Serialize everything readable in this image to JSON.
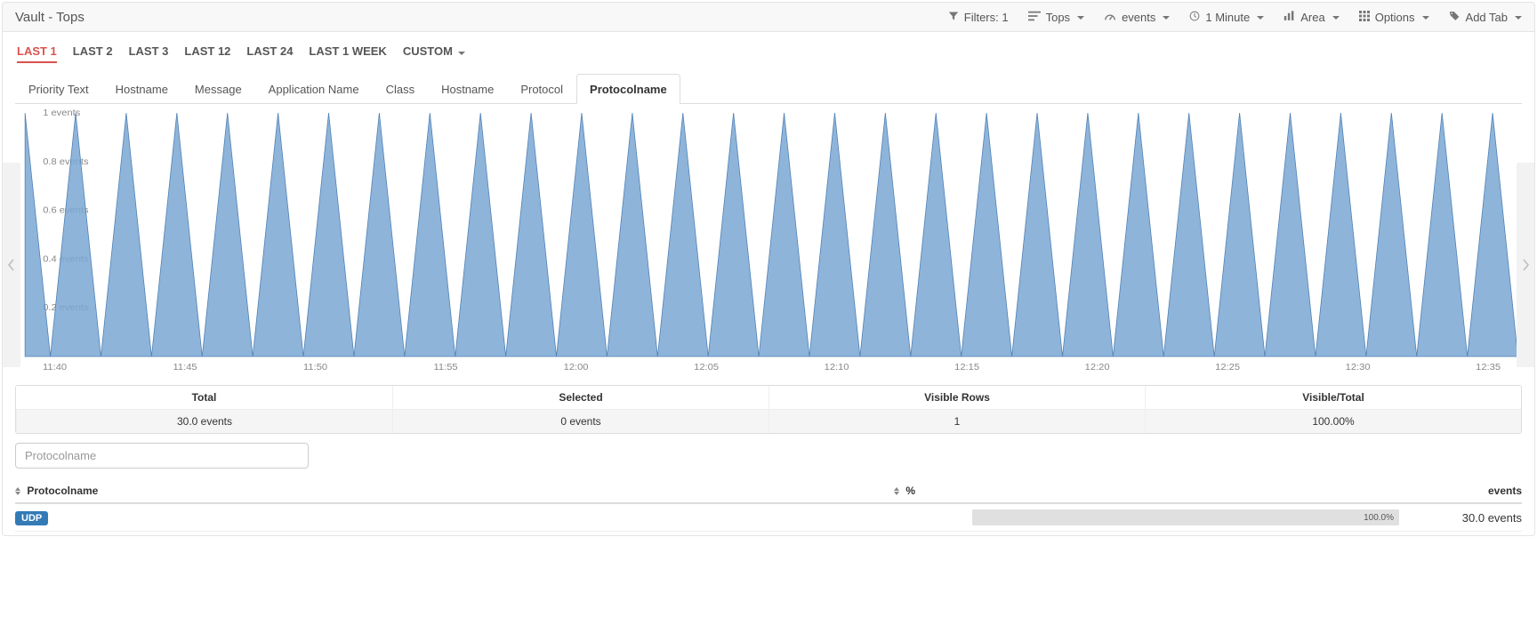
{
  "topbar": {
    "title": "Vault - Tops",
    "filters": "Filters: 1",
    "tops": "Tops",
    "events": "events",
    "interval": "1 Minute",
    "area": "Area",
    "options": "Options",
    "add_tab": "Add Tab"
  },
  "time_tabs": [
    "LAST 1",
    "LAST 2",
    "LAST 3",
    "LAST 12",
    "LAST 24",
    "LAST 1 WEEK",
    "CUSTOM"
  ],
  "time_tabs_active": 0,
  "col_tabs": [
    "Priority Text",
    "Hostname",
    "Message",
    "Application Name",
    "Class",
    "Hostname",
    "Protocol",
    "Protocolname"
  ],
  "col_tabs_active": 7,
  "summary": {
    "headers": [
      "Total",
      "Selected",
      "Visible Rows",
      "Visible/Total"
    ],
    "values": [
      "30.0 events",
      "0 events",
      "1",
      "100.00%"
    ]
  },
  "filter_placeholder": "Protocolname",
  "table": {
    "col_name": "Protocolname",
    "col_pct": "%",
    "col_events": "events",
    "rows": [
      {
        "name": "UDP",
        "pct_label": "100.0%",
        "pct": 100,
        "events": "30.0 events"
      }
    ]
  },
  "chart_data": {
    "type": "area",
    "ylabel_suffix": " events",
    "ylim": [
      0,
      1
    ],
    "yticks": [
      0.2,
      0.4,
      0.6,
      0.8,
      1
    ],
    "x_ticks": [
      "11:40",
      "11:45",
      "11:50",
      "11:55",
      "12:00",
      "12:05",
      "12:10",
      "12:15",
      "12:20",
      "12:25",
      "12:30",
      "12:35"
    ],
    "n_points": 60,
    "series": [
      {
        "name": "UDP",
        "color": "#7aa7d2",
        "pattern": "alt01"
      }
    ]
  }
}
